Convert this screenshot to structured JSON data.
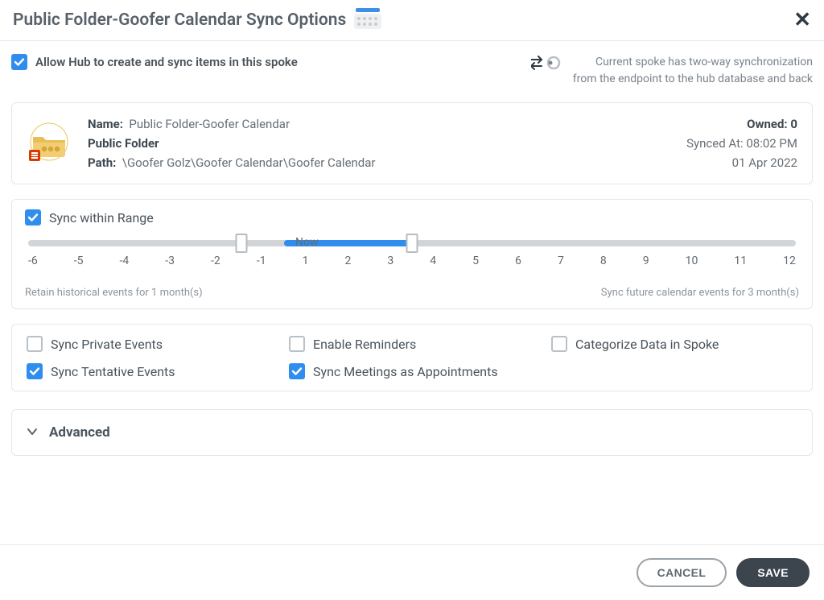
{
  "header": {
    "title": "Public Folder-Goofer Calendar Sync Options"
  },
  "allow": {
    "checked": true,
    "label": "Allow Hub to create and sync items in this spoke"
  },
  "sync_summary": {
    "line1": "Current spoke has two-way synchronization",
    "line2": "from the endpoint to the hub database and back"
  },
  "meta": {
    "name_label": "Name:",
    "name_value": "Public Folder-Goofer Calendar",
    "type": "Public Folder",
    "path_label": "Path:",
    "path_value": "\\Goofer Golz\\Goofer Calendar\\Goofer Calendar",
    "owned_label": "Owned:",
    "owned_value": "0",
    "synced_label": "Synced At:",
    "synced_time": "08:02 PM",
    "synced_date": "01 Apr 2022"
  },
  "range": {
    "checked": true,
    "label": "Sync within Range",
    "now_label": "Now",
    "ticks": [
      "-6",
      "-5",
      "-4",
      "-3",
      "-2",
      "-1",
      "1",
      "2",
      "3",
      "4",
      "5",
      "6",
      "7",
      "8",
      "9",
      "10",
      "11",
      "12"
    ],
    "retain_text": "Retain historical events for 1 month(s)",
    "future_text": "Sync future calendar events for 3 month(s)",
    "min": -6,
    "max": 12,
    "handle_low": -1,
    "handle_high": 3,
    "now_pos": 0
  },
  "options": [
    {
      "key": "sync-private",
      "label": "Sync Private Events",
      "checked": false,
      "col": 1,
      "row": 1
    },
    {
      "key": "sync-tentative",
      "label": "Sync Tentative Events",
      "checked": true,
      "col": 1,
      "row": 2
    },
    {
      "key": "enable-rem",
      "label": "Enable Reminders",
      "checked": false,
      "col": 2,
      "row": 1
    },
    {
      "key": "sync-meetings",
      "label": "Sync Meetings as Appointments",
      "checked": true,
      "col": 2,
      "row": 2
    },
    {
      "key": "categorize",
      "label": "Categorize Data in Spoke",
      "checked": false,
      "col": 3,
      "row": 1
    }
  ],
  "advanced": {
    "label": "Advanced"
  },
  "footer": {
    "cancel": "CANCEL",
    "save": "SAVE"
  }
}
